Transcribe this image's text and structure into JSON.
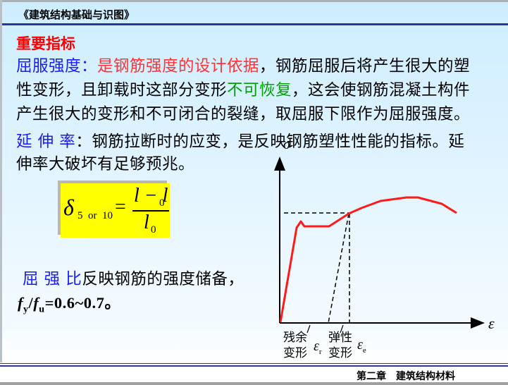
{
  "header": {
    "title": "《建筑结构基础与识图》"
  },
  "section_title": "重要指标",
  "yield": {
    "term": "屈服强度",
    "colon": "：",
    "highlight": "是钢筋强度的设计依据",
    "rest1": "，钢筋屈服后将产生很大的塑",
    "line2a": "性变形，且卸载时这部分变形",
    "green": "不可恢复",
    "line2b": "，这会使钢筋混凝土构件",
    "line3": "产生很大的变形和不可闭合的裂缝，取屈服下限作为屈服强度。"
  },
  "elong": {
    "term": "延 伸 率",
    "rest1": "：钢筋拉断时的应变，是反映钢筋塑性性能的指标。延",
    "line2": "伸率大破坏有足够预兆。"
  },
  "formula": {
    "delta": "δ",
    "sub": "5  or  10",
    "eq": "=",
    "num": "l − l",
    "num_sub": "0",
    "den": "l",
    "den_sub": "0"
  },
  "ratio": {
    "term": "屈 强 比",
    "rest": "反映钢筋的强度储备，",
    "f1": "f",
    "s1": "y",
    "slash": "/",
    "f2": "f",
    "s2": "u",
    "value": "=0.6~0.7。"
  },
  "diagram": {
    "y_axis": "σ",
    "x_axis": "ε",
    "residual_label": "残余\n变形",
    "residual_sym": "ε",
    "residual_sub": "r",
    "elastic_label": "弹性\n变形",
    "elastic_sym": "ε",
    "elastic_sub": "e",
    "curve_color": "#ff1a1a"
  },
  "footer": {
    "text": "第二章　建筑结构材料"
  }
}
